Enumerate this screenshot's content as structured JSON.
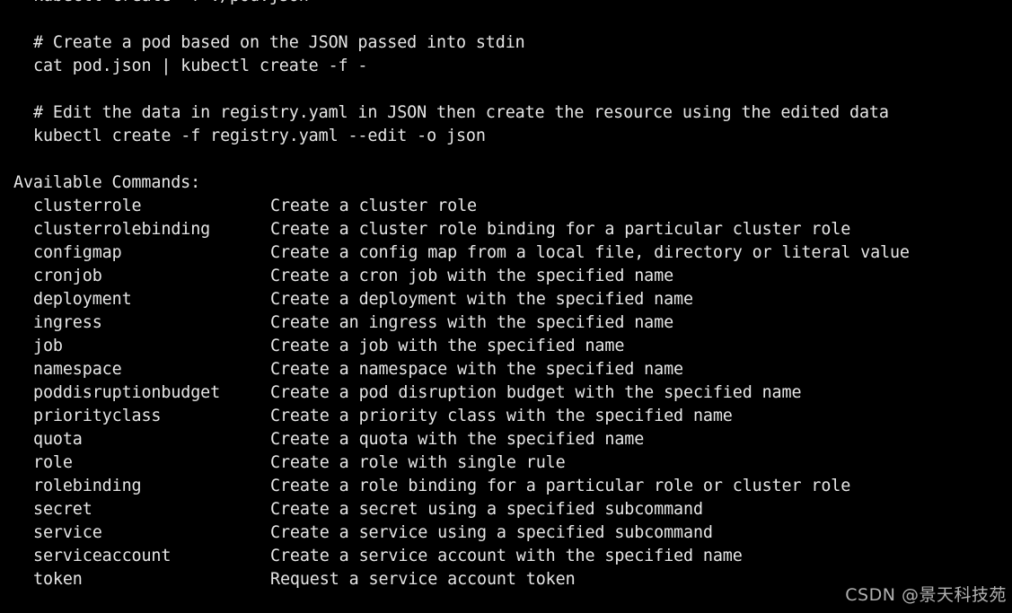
{
  "examples": [
    {
      "cmd": "kubectl create -f ./pod.json"
    },
    {
      "comment": "# Create a pod based on the JSON passed into stdin",
      "cmd": "cat pod.json | kubectl create -f -"
    },
    {
      "comment": "# Edit the data in registry.yaml in JSON then create the resource using the edited data",
      "cmd": "kubectl create -f registry.yaml --edit -o json"
    }
  ],
  "available_commands_header": "Available Commands:",
  "commands": [
    {
      "name": "clusterrole",
      "desc": "Create a cluster role"
    },
    {
      "name": "clusterrolebinding",
      "desc": "Create a cluster role binding for a particular cluster role"
    },
    {
      "name": "configmap",
      "desc": "Create a config map from a local file, directory or literal value"
    },
    {
      "name": "cronjob",
      "desc": "Create a cron job with the specified name"
    },
    {
      "name": "deployment",
      "desc": "Create a deployment with the specified name"
    },
    {
      "name": "ingress",
      "desc": "Create an ingress with the specified name"
    },
    {
      "name": "job",
      "desc": "Create a job with the specified name"
    },
    {
      "name": "namespace",
      "desc": "Create a namespace with the specified name"
    },
    {
      "name": "poddisruptionbudget",
      "desc": "Create a pod disruption budget with the specified name"
    },
    {
      "name": "priorityclass",
      "desc": "Create a priority class with the specified name"
    },
    {
      "name": "quota",
      "desc": "Create a quota with the specified name"
    },
    {
      "name": "role",
      "desc": "Create a role with single rule"
    },
    {
      "name": "rolebinding",
      "desc": "Create a role binding for a particular role or cluster role"
    },
    {
      "name": "secret",
      "desc": "Create a secret using a specified subcommand"
    },
    {
      "name": "service",
      "desc": "Create a service using a specified subcommand"
    },
    {
      "name": "serviceaccount",
      "desc": "Create a service account with the specified name"
    },
    {
      "name": "token",
      "desc": "Request a service account token"
    }
  ],
  "watermark": "CSDN @景天科技苑",
  "colors": {
    "background": "#000000",
    "text": "#e6e6e6"
  }
}
